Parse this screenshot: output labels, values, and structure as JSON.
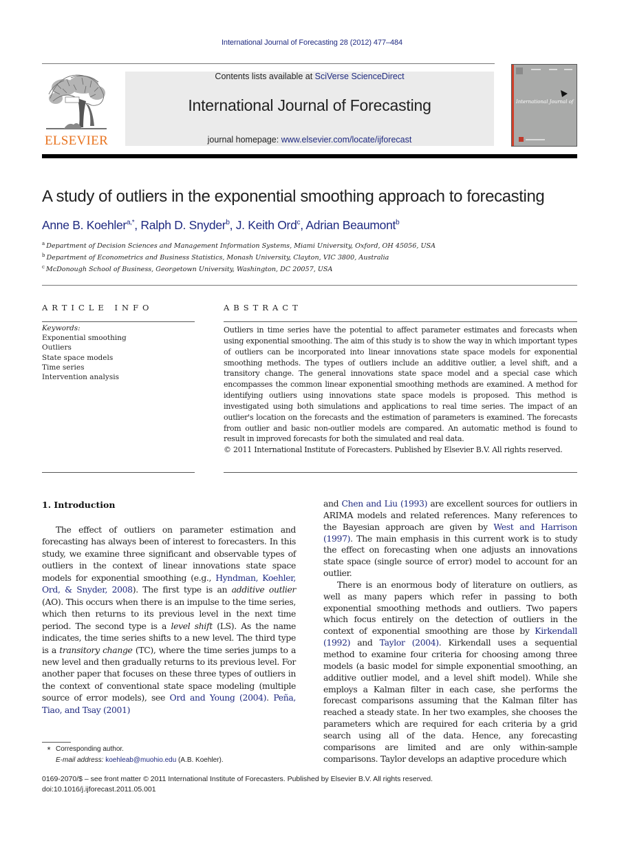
{
  "journal_ref": "International Journal of Forecasting 28 (2012) 477–484",
  "header": {
    "contents_prefix": "Contents lists available at ",
    "contents_link": "SciVerse ScienceDirect",
    "journal_title": "International Journal of Forecasting",
    "homepage_prefix": "journal homepage: ",
    "homepage_link": "www.elsevier.com/locate/ijforecast",
    "publisher_logo_text": "ELSEVIER",
    "cover_title": "International Journal of Forecasting",
    "colors": {
      "link": "#1f2a80",
      "elsevier_orange": "#e8731f",
      "cover_gray": "#a9aaa9",
      "cover_spine": "#d0402b"
    }
  },
  "article": {
    "title": "A study of outliers in the exponential smoothing approach to forecasting",
    "authors": [
      {
        "name": "Anne B. Koehler",
        "sup": "a,*"
      },
      {
        "name": "Ralph D. Snyder",
        "sup": "b"
      },
      {
        "name": "J. Keith Ord",
        "sup": "c"
      },
      {
        "name": "Adrian Beaumont",
        "sup": "b"
      }
    ],
    "affiliations": [
      {
        "mark": "a",
        "text": "Department of Decision Sciences and Management Information Systems, Miami University, Oxford, OH 45056, USA"
      },
      {
        "mark": "b",
        "text": "Department of Econometrics and Business Statistics, Monash University, Clayton, VIC 3800, Australia"
      },
      {
        "mark": "c",
        "text": "McDonough School of Business, Georgetown University, Washington, DC 20057, USA"
      }
    ]
  },
  "article_info": {
    "heading": "ARTICLE INFO",
    "keywords_label": "Keywords:",
    "keywords": [
      "Exponential smoothing",
      "Outliers",
      "State space models",
      "Time series",
      "Intervention analysis"
    ]
  },
  "abstract": {
    "heading": "ABSTRACT",
    "text": "Outliers in time series have the potential to affect parameter estimates and forecasts when using exponential smoothing. The aim of this study is to show the way in which important types of outliers can be incorporated into linear innovations state space models for exponential smoothing methods. The types of outliers include an additive outlier, a level shift, and a transitory change. The general innovations state space model and a special case which encompasses the common linear exponential smoothing methods are examined. A method for identifying outliers using innovations state space models is proposed. This method is investigated using both simulations and applications to real time series. The impact of an outlier's location on the forecasts and the estimation of parameters is examined. The forecasts from outlier and basic non-outlier models are compared. An automatic method is found to result in improved forecasts for both the simulated and real data.",
    "copyright": "© 2011 International Institute of Forecasters. Published by Elsevier B.V. All rights reserved."
  },
  "introduction": {
    "heading": "1.  Introduction",
    "left": {
      "t1": "The effect of outliers on parameter estimation and forecasting has always been of interest to forecasters. In this study, we examine three significant and observable types of outliers in the context of linear innovations state space models for exponential smoothing (e.g., ",
      "cite1": "Hyndman, Koehler, Ord, & Snyder, 2008",
      "t2": "). The first type is an ",
      "em1": "additive outlier",
      "t3": " (AO). This occurs when there is an impulse to the time series, which then returns to its previous level in the next time period. The second type is a ",
      "em2": "level shift",
      "t4": " (LS). As the name indicates, the time series shifts to a new level. The third type is a ",
      "em3": "transitory change",
      "t5": " (TC), where the time series jumps to a new level and then gradually returns to its previous level. For another paper that focuses on these three types of outliers in the context of conventional state space modeling (multiple source of error models), see ",
      "cite2": "Ord and Young (2004)",
      "t6": ". ",
      "cite3": "Peña, Tiao, and Tsay (2001)"
    },
    "right": {
      "t1": "and ",
      "cite1": "Chen and Liu (1993)",
      "t2": " are excellent sources for outliers in ARIMA models and related references. Many references to the Bayesian approach are given by ",
      "cite2": "West and Harrison (1997)",
      "t3": ". The main emphasis in this current work is to study the effect on forecasting when one adjusts an innovations state space (single source of error) model to account for an outlier.",
      "p2_t1": "There is an enormous body of literature on outliers, as well as many papers which refer in passing to both exponential smoothing methods and outliers. Two papers which focus entirely on the detection of outliers in the context of exponential smoothing are those by ",
      "cite3": "Kirkendall (1992)",
      "p2_t2": " and ",
      "cite4": "Taylor (2004)",
      "p2_t3": ". Kirkendall uses a sequential method to examine four criteria for choosing among three models (a basic model for simple exponential smoothing, an additive outlier model, and a level shift model). While she employs a Kalman filter in each case, she performs the forecast comparisons assuming that the Kalman filter has reached a steady state. In her two examples, she chooses the parameters which are required for each criteria by a grid search using all of the data. Hence, any forecasting comparisons are limited and are only within-sample comparisons. Taylor develops an adaptive procedure which"
    }
  },
  "footnotes": {
    "star": "*",
    "corresponding": "Corresponding author.",
    "email_label": "E-mail address:",
    "email": "koehleab@muohio.edu",
    "email_owner": " (A.B. Koehler)."
  },
  "bottom": {
    "issn_line": "0169-2070/$ – see front matter © 2011 International Institute of Forecasters. Published by Elsevier B.V. All rights reserved.",
    "doi": "doi:10.1016/j.ijforecast.2011.05.001"
  }
}
